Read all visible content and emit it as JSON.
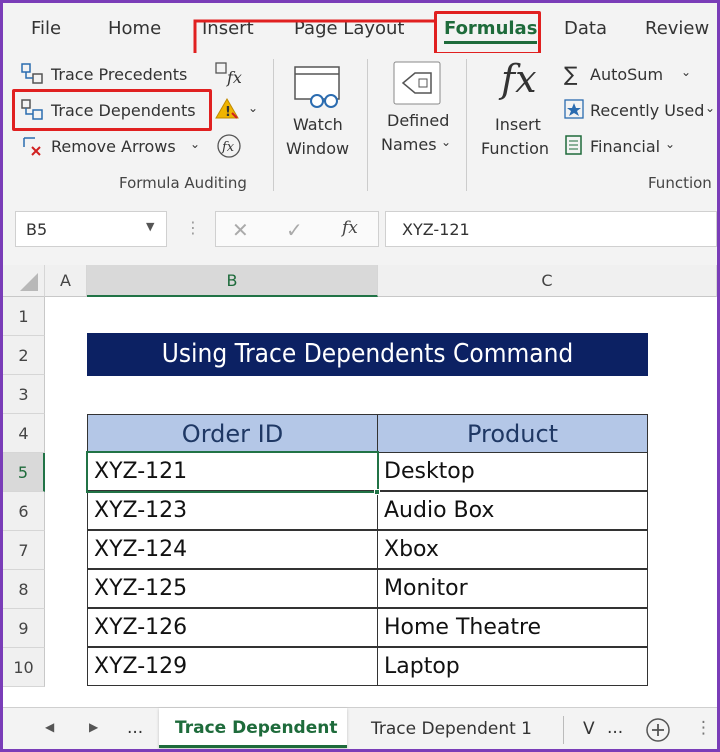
{
  "ribbon_tabs": [
    "File",
    "Home",
    "Insert",
    "Page Layout",
    "Formulas",
    "Data",
    "Review"
  ],
  "active_tab": "Formulas",
  "formula_auditing": {
    "trace_precedents": "Trace Precedents",
    "trace_dependents": "Trace Dependents",
    "remove_arrows": "Remove Arrows",
    "group_label": "Formula Auditing"
  },
  "watch_window": {
    "line1": "Watch",
    "line2": "Window"
  },
  "defined_names": {
    "line1": "Defined",
    "line2": "Names"
  },
  "insert_function": {
    "line1": "Insert",
    "line2": "Function"
  },
  "function_library": {
    "autosum": "AutoSum",
    "recently_used": "Recently Used",
    "financial": "Financial",
    "group_label": "Function"
  },
  "formula_bar": {
    "name_box": "B5",
    "fx": "fx",
    "value": "XYZ-121"
  },
  "columns": [
    "A",
    "B",
    "C"
  ],
  "rows": [
    "1",
    "2",
    "3",
    "4",
    "5",
    "6",
    "7",
    "8",
    "9",
    "10"
  ],
  "sheet_title": "Using Trace Dependents Command",
  "table": {
    "headers": [
      "Order ID",
      "Product"
    ],
    "rows": [
      [
        "XYZ-121",
        "Desktop"
      ],
      [
        "XYZ-123",
        "Audio Box"
      ],
      [
        "XYZ-124",
        "Xbox"
      ],
      [
        "XYZ-125",
        "Monitor"
      ],
      [
        "XYZ-126",
        "Home Theatre"
      ],
      [
        "XYZ-129",
        "Laptop"
      ]
    ]
  },
  "sheet_tabs": {
    "dots": "...",
    "active": "Trace Dependent",
    "second": "Trace Dependent 1",
    "third": "V",
    "more": "..."
  },
  "colors": {
    "accent_red": "#e02020",
    "title_bg": "#0c2163",
    "header_bg": "#b4c7e7",
    "frame": "#7a3db8"
  }
}
